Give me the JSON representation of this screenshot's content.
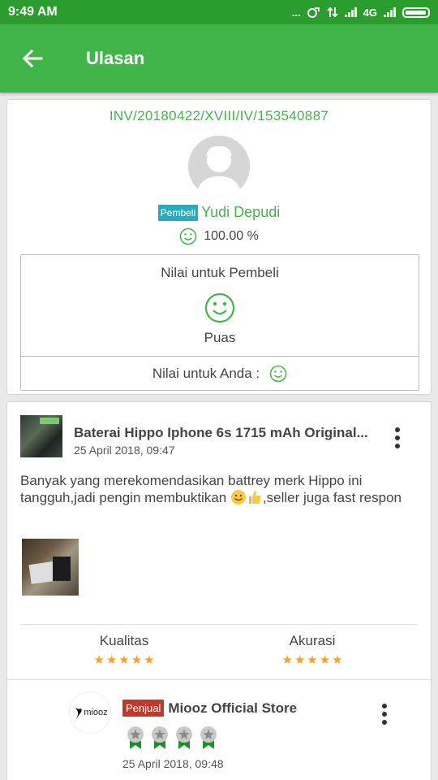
{
  "status_bar": {
    "time": "9:49 AM",
    "dots": "...",
    "network": "4G"
  },
  "app_bar": {
    "title": "Ulasan"
  },
  "invoice": {
    "number": "INV/20180422/XVIII/IV/153540887",
    "buyer_badge": "Pembeli",
    "buyer_name": "Yudi Depudi",
    "buyer_reputation": "100.00 %"
  },
  "rating_box": {
    "title": "Nilai untuk Pembeli",
    "result": "Puas",
    "your_rating_label": "Nilai untuk Anda :"
  },
  "review": {
    "product_name": "Baterai Hippo Iphone 6s 1715 mAh Original...",
    "date": "25 April 2018, 09:47",
    "text_part1": "Banyak yang merekomendasikan battrey merk Hippo ini tangguh,jadi pengin membuktikan ",
    "text_part2": ",seller juga fast respon",
    "metrics": [
      {
        "label": "Kualitas",
        "stars": 5
      },
      {
        "label": "Akurasi",
        "stars": 5
      }
    ]
  },
  "seller_reply": {
    "logo_text": "miooz",
    "badge": "Penjual",
    "name": "Miooz Official Store",
    "medal_count": 4,
    "date": "25 April 2018, 09:48"
  },
  "colors": {
    "primary_green": "#42b549",
    "statusbar_green": "#2b9d2f",
    "buyer_badge": "#2aaaba",
    "seller_badge": "#c0392b",
    "star": "#ff9d2a"
  }
}
